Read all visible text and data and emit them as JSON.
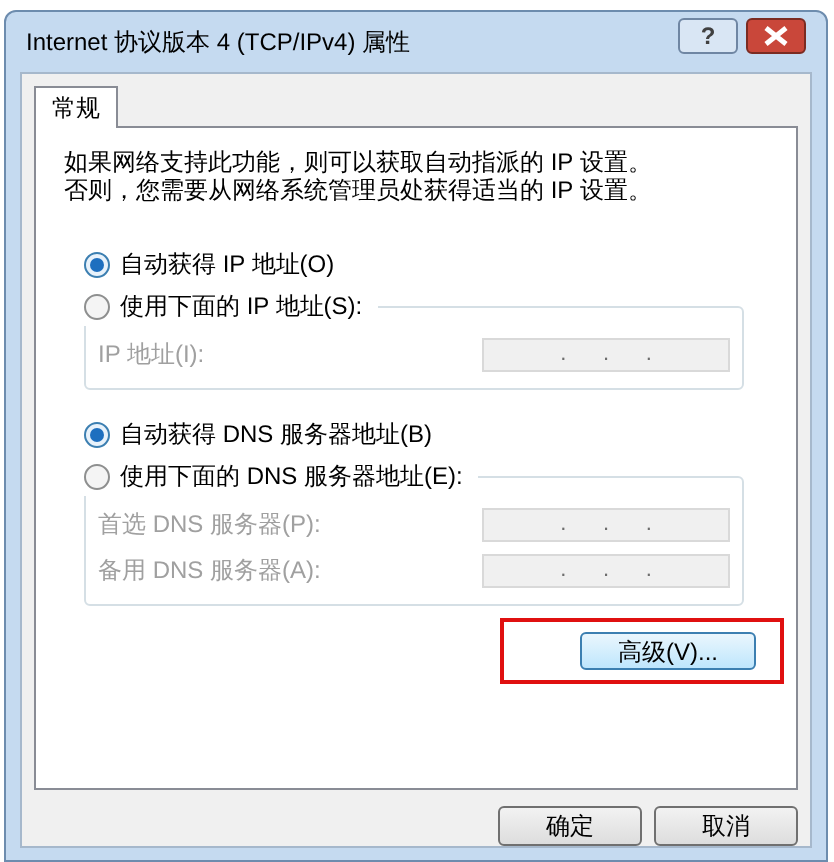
{
  "window": {
    "title": "Internet 协议版本 4 (TCP/IPv4) 属性",
    "help": "?"
  },
  "tabs": [
    {
      "label": "常规",
      "selected": true
    }
  ],
  "intro": "如果网络支持此功能，则可以获取自动指派的 IP 设置。否则，您需要从网络系统管理员处获得适当的 IP 设置。",
  "groups": [
    {
      "options": [
        {
          "label": "自动获得 IP 地址(O)",
          "selected": true
        },
        {
          "label": "使用下面的 IP 地址(S):",
          "selected": false
        }
      ],
      "fields": [
        {
          "label": "IP 地址(I):",
          "value": ".      .      .",
          "disabled": true
        }
      ]
    },
    {
      "options": [
        {
          "label": "自动获得 DNS 服务器地址(B)",
          "selected": true
        },
        {
          "label": "使用下面的 DNS 服务器地址(E):",
          "selected": false
        }
      ],
      "fields": [
        {
          "label": "首选 DNS 服务器(P):",
          "value": ".      .      .",
          "disabled": true
        },
        {
          "label": "备用 DNS 服务器(A):",
          "value": ".      .      .",
          "disabled": true
        }
      ]
    }
  ],
  "advanced_button": {
    "label": "高级(V)...",
    "highlighted": true
  },
  "buttons": [
    "确定",
    "取消"
  ]
}
